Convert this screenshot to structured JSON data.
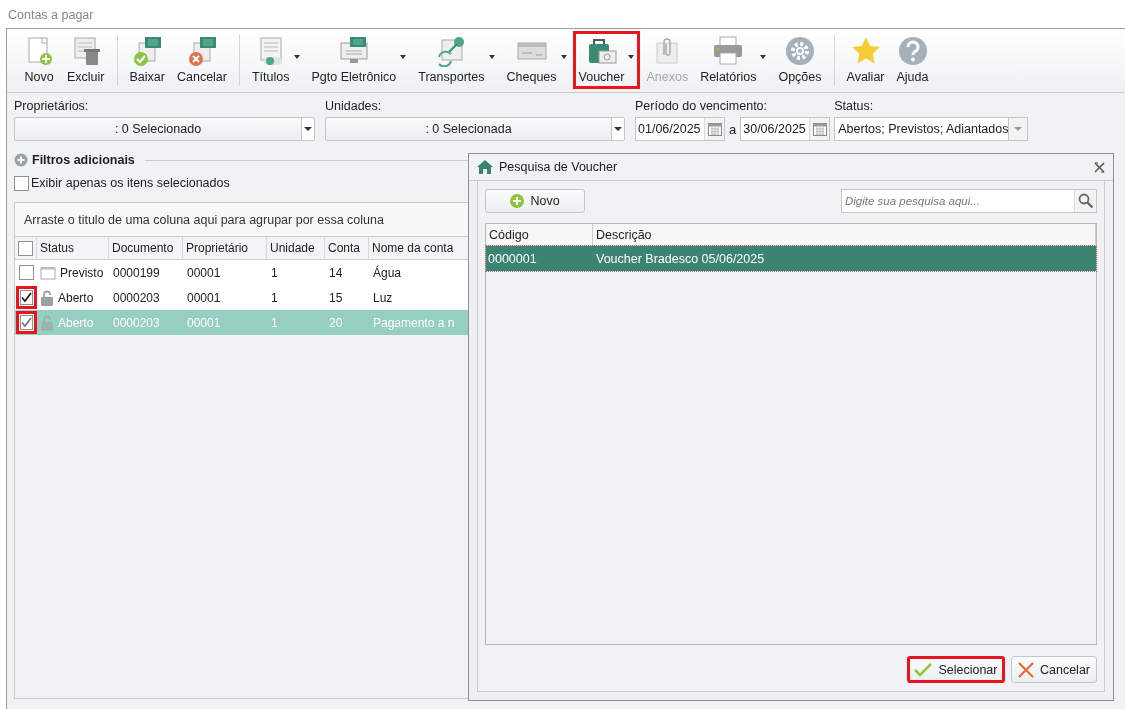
{
  "window": {
    "title": "Contas a pagar"
  },
  "toolbar": {
    "groups": [
      [
        {
          "label": "Novo",
          "dropdown": false,
          "disabled": false,
          "highlighted": false
        },
        {
          "label": "Excluir",
          "dropdown": false,
          "disabled": false,
          "highlighted": false
        }
      ],
      [
        {
          "label": "Baixar",
          "dropdown": false,
          "disabled": false,
          "highlighted": false
        },
        {
          "label": "Cancelar",
          "dropdown": false,
          "disabled": false,
          "highlighted": false
        }
      ],
      [
        {
          "label": "Títulos",
          "dropdown": true,
          "disabled": false,
          "highlighted": false
        },
        {
          "label": "Pgto Eletrônico",
          "dropdown": true,
          "disabled": false,
          "highlighted": false
        },
        {
          "label": "Transportes",
          "dropdown": true,
          "disabled": false,
          "highlighted": false
        },
        {
          "label": "Cheques",
          "dropdown": true,
          "disabled": false,
          "highlighted": false
        },
        {
          "label": "Voucher",
          "dropdown": true,
          "disabled": false,
          "highlighted": true
        },
        {
          "label": "Anexos",
          "dropdown": false,
          "disabled": true,
          "highlighted": false
        },
        {
          "label": "Relatórios",
          "dropdown": true,
          "disabled": false,
          "highlighted": false
        },
        {
          "label": "Opções",
          "dropdown": false,
          "disabled": false,
          "highlighted": false
        }
      ],
      [
        {
          "label": "Avaliar",
          "dropdown": false,
          "disabled": false,
          "highlighted": false
        },
        {
          "label": "Ajuda",
          "dropdown": false,
          "disabled": false,
          "highlighted": false
        }
      ]
    ]
  },
  "filters": {
    "owners": {
      "label": "Proprietários:",
      "value": ": 0 Selecionado"
    },
    "units": {
      "label": "Unidades:",
      "value": ": 0 Selecionada"
    },
    "period": {
      "label": "Período do vencimento:",
      "from": "01/06/2025",
      "separator": "a",
      "to": "30/06/2025"
    },
    "status": {
      "label": "Status:",
      "value": "Abertos; Previstos; Adiantados"
    }
  },
  "additional_filters": {
    "title": "Filtros adicionais",
    "show_selected_only": {
      "label": "Exibir apenas os itens selecionados",
      "checked": false
    }
  },
  "main_grid": {
    "group_hint": "Arraste o titulo de uma coluna aqui para agrupar por essa coluna",
    "all_checked": false,
    "columns": [
      "Status",
      "Documento",
      "Proprietário",
      "Unidade",
      "Conta",
      "Nome da conta"
    ],
    "rows": [
      {
        "kind": "forecast",
        "checked": false,
        "selected": false,
        "highlighted": false,
        "cells": [
          "Previsto",
          "0000199",
          "00001",
          "1",
          "14",
          "Água"
        ]
      },
      {
        "kind": "open",
        "checked": true,
        "selected": false,
        "highlighted": true,
        "cells": [
          "Aberto",
          "0000203",
          "00001",
          "1",
          "15",
          "Luz"
        ]
      },
      {
        "kind": "open",
        "checked": true,
        "selected": true,
        "highlighted": true,
        "cells": [
          "Aberto",
          "0000203",
          "00001",
          "1",
          "20",
          "Pagamento a n"
        ]
      }
    ]
  },
  "dialog": {
    "title": "Pesquisa de Voucher",
    "new_button": "Novo",
    "search": {
      "placeholder": "Digite sua pesquisa aqui..."
    },
    "columns": [
      "Código",
      "Descrição"
    ],
    "rows": [
      {
        "selected": true,
        "cells": [
          "0000001",
          "Voucher Bradesco 05/06/2025"
        ]
      }
    ],
    "buttons": [
      {
        "kind": "confirm",
        "label": "Selecionar",
        "highlighted": true
      },
      {
        "kind": "cancel",
        "label": "Cancelar",
        "highlighted": false
      }
    ]
  }
}
